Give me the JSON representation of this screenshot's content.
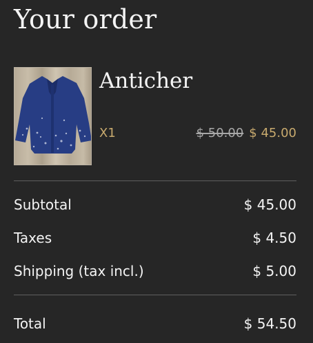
{
  "order": {
    "title": "Your order"
  },
  "item": {
    "name": "Anticher",
    "quantity": "X1",
    "original_price": "$ 50.00",
    "sale_price": "$ 45.00",
    "image": "blue-shirt-photo"
  },
  "summary": {
    "subtotal_label": "Subtotal",
    "subtotal_value": "$ 45.00",
    "taxes_label": "Taxes",
    "taxes_value": "$ 4.50",
    "shipping_label": "Shipping (tax incl.)",
    "shipping_value": "$ 5.00",
    "total_label": "Total",
    "total_value": "$ 54.50"
  },
  "colors": {
    "background": "#262626",
    "text": "#f4f4f4",
    "accent": "#c8aa6e",
    "muted": "#a8a8a8",
    "divider": "#5f5f5f"
  }
}
